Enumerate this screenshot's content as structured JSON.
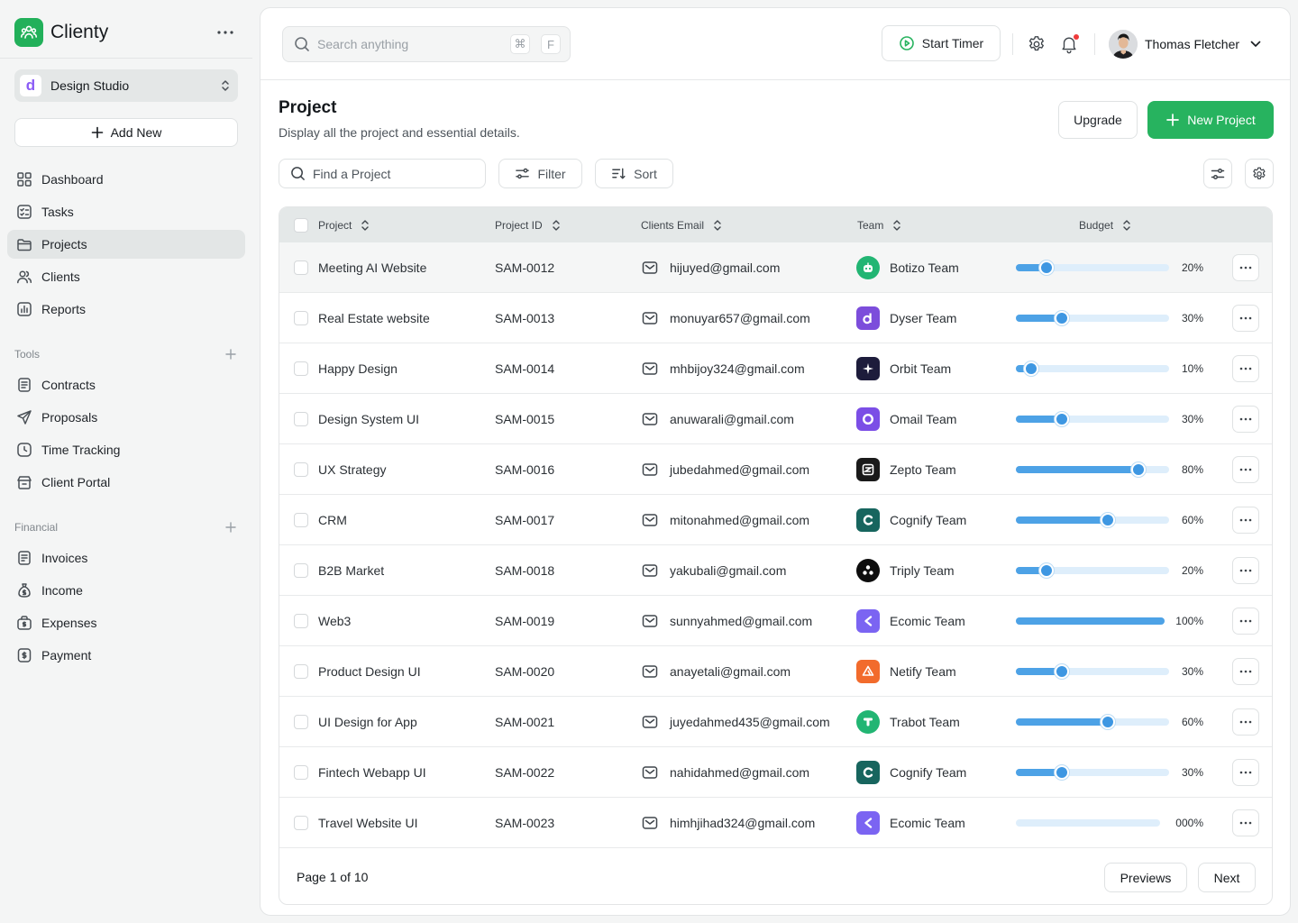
{
  "brand": {
    "name": "Clienty",
    "icon": "users-group-icon",
    "color": "#22b05a"
  },
  "workspace": {
    "logo_letter": "d",
    "name": "Design Studio"
  },
  "sidebar": {
    "add_new": "Add New",
    "main_items": [
      {
        "label": "Dashboard",
        "icon": "dashboard-icon"
      },
      {
        "label": "Tasks",
        "icon": "tasks-icon"
      },
      {
        "label": "Projects",
        "icon": "folder-icon",
        "active": true
      },
      {
        "label": "Clients",
        "icon": "users-icon"
      },
      {
        "label": "Reports",
        "icon": "chart-icon"
      }
    ],
    "tools_label": "Tools",
    "tools_items": [
      {
        "label": "Contracts",
        "icon": "document-icon"
      },
      {
        "label": "Proposals",
        "icon": "send-icon"
      },
      {
        "label": "Time Tracking",
        "icon": "clock-icon"
      },
      {
        "label": "Client Portal",
        "icon": "portal-icon"
      }
    ],
    "financial_label": "Financial",
    "financial_items": [
      {
        "label": "Invoices",
        "icon": "invoice-icon"
      },
      {
        "label": "Income",
        "icon": "money-bag-icon"
      },
      {
        "label": "Expenses",
        "icon": "expenses-icon"
      },
      {
        "label": "Payment",
        "icon": "payment-icon"
      }
    ]
  },
  "topbar": {
    "search_placeholder": "Search anything",
    "shortcut_key1": "⌘",
    "shortcut_key2": "F",
    "start_timer": "Start Timer",
    "user_name": "Thomas Fletcher"
  },
  "page": {
    "title": "Project",
    "subtitle": "Display all the project and essential details.",
    "upgrade": "Upgrade",
    "new_project": "New Project",
    "find_placeholder": "Find a Project",
    "filter": "Filter",
    "sort": "Sort"
  },
  "table": {
    "columns": [
      "Project",
      "Project ID",
      "Clients Email",
      "Team",
      "Budget"
    ],
    "rows": [
      {
        "project": "Meeting AI Website",
        "id": "SAM-0012",
        "email": "hijuyed@gmail.com",
        "team": "Botizo Team",
        "logo": "botizo",
        "budget": 20,
        "budget_text": "20%"
      },
      {
        "project": "Real Estate website",
        "id": "SAM-0013",
        "email": "monuyar657@gmail.com",
        "team": "Dyser Team",
        "logo": "dyser",
        "budget": 30,
        "budget_text": "30%"
      },
      {
        "project": "Happy Design",
        "id": "SAM-0014",
        "email": "mhbijoy324@gmail.com",
        "team": "Orbit Team",
        "logo": "orbit",
        "budget": 10,
        "budget_text": "10%"
      },
      {
        "project": "Design System UI",
        "id": "SAM-0015",
        "email": "anuwarali@gmail.com",
        "team": "Omail Team",
        "logo": "omail",
        "budget": 30,
        "budget_text": "30%"
      },
      {
        "project": "UX Strategy",
        "id": "SAM-0016",
        "email": "jubedahmed@gmail.com",
        "team": "Zepto Team",
        "logo": "zepto",
        "budget": 80,
        "budget_text": "80%"
      },
      {
        "project": "CRM",
        "id": "SAM-0017",
        "email": "mitonahmed@gmail.com",
        "team": "Cognify Team",
        "logo": "cognify",
        "budget": 60,
        "budget_text": "60%"
      },
      {
        "project": "B2B Market",
        "id": "SAM-0018",
        "email": "yakubali@gmail.com",
        "team": "Triply Team",
        "logo": "triply",
        "budget": 20,
        "budget_text": "20%"
      },
      {
        "project": "Web3",
        "id": "SAM-0019",
        "email": "sunnyahmed@gmail.com",
        "team": "Ecomic Team",
        "logo": "ecomic",
        "budget": 100,
        "budget_text": "100%"
      },
      {
        "project": "Product Design UI",
        "id": "SAM-0020",
        "email": "anayetali@gmail.com",
        "team": "Netify Team",
        "logo": "netify",
        "budget": 30,
        "budget_text": "30%"
      },
      {
        "project": "UI Design for App",
        "id": "SAM-0021",
        "email": "juyedahmed435@gmail.com",
        "team": "Trabot Team",
        "logo": "trabot",
        "budget": 60,
        "budget_text": "60%"
      },
      {
        "project": "Fintech Webapp UI",
        "id": "SAM-0022",
        "email": "nahidahmed@gmail.com",
        "team": "Cognify Team",
        "logo": "cognify",
        "budget": 30,
        "budget_text": "30%"
      },
      {
        "project": "Travel Website UI",
        "id": "SAM-0023",
        "email": "himhjihad324@gmail.com",
        "team": "Ecomic Team",
        "logo": "ecomic",
        "budget": 0,
        "budget_text": "000%"
      }
    ]
  },
  "pagination": {
    "info": "Page 1 of 10",
    "prev": "Previews",
    "next": "Next"
  },
  "colors": {
    "accent": "#27b35f",
    "bar": "#4da2e6",
    "bar_track": "#deeefb",
    "notification": "#ef3b3b"
  }
}
